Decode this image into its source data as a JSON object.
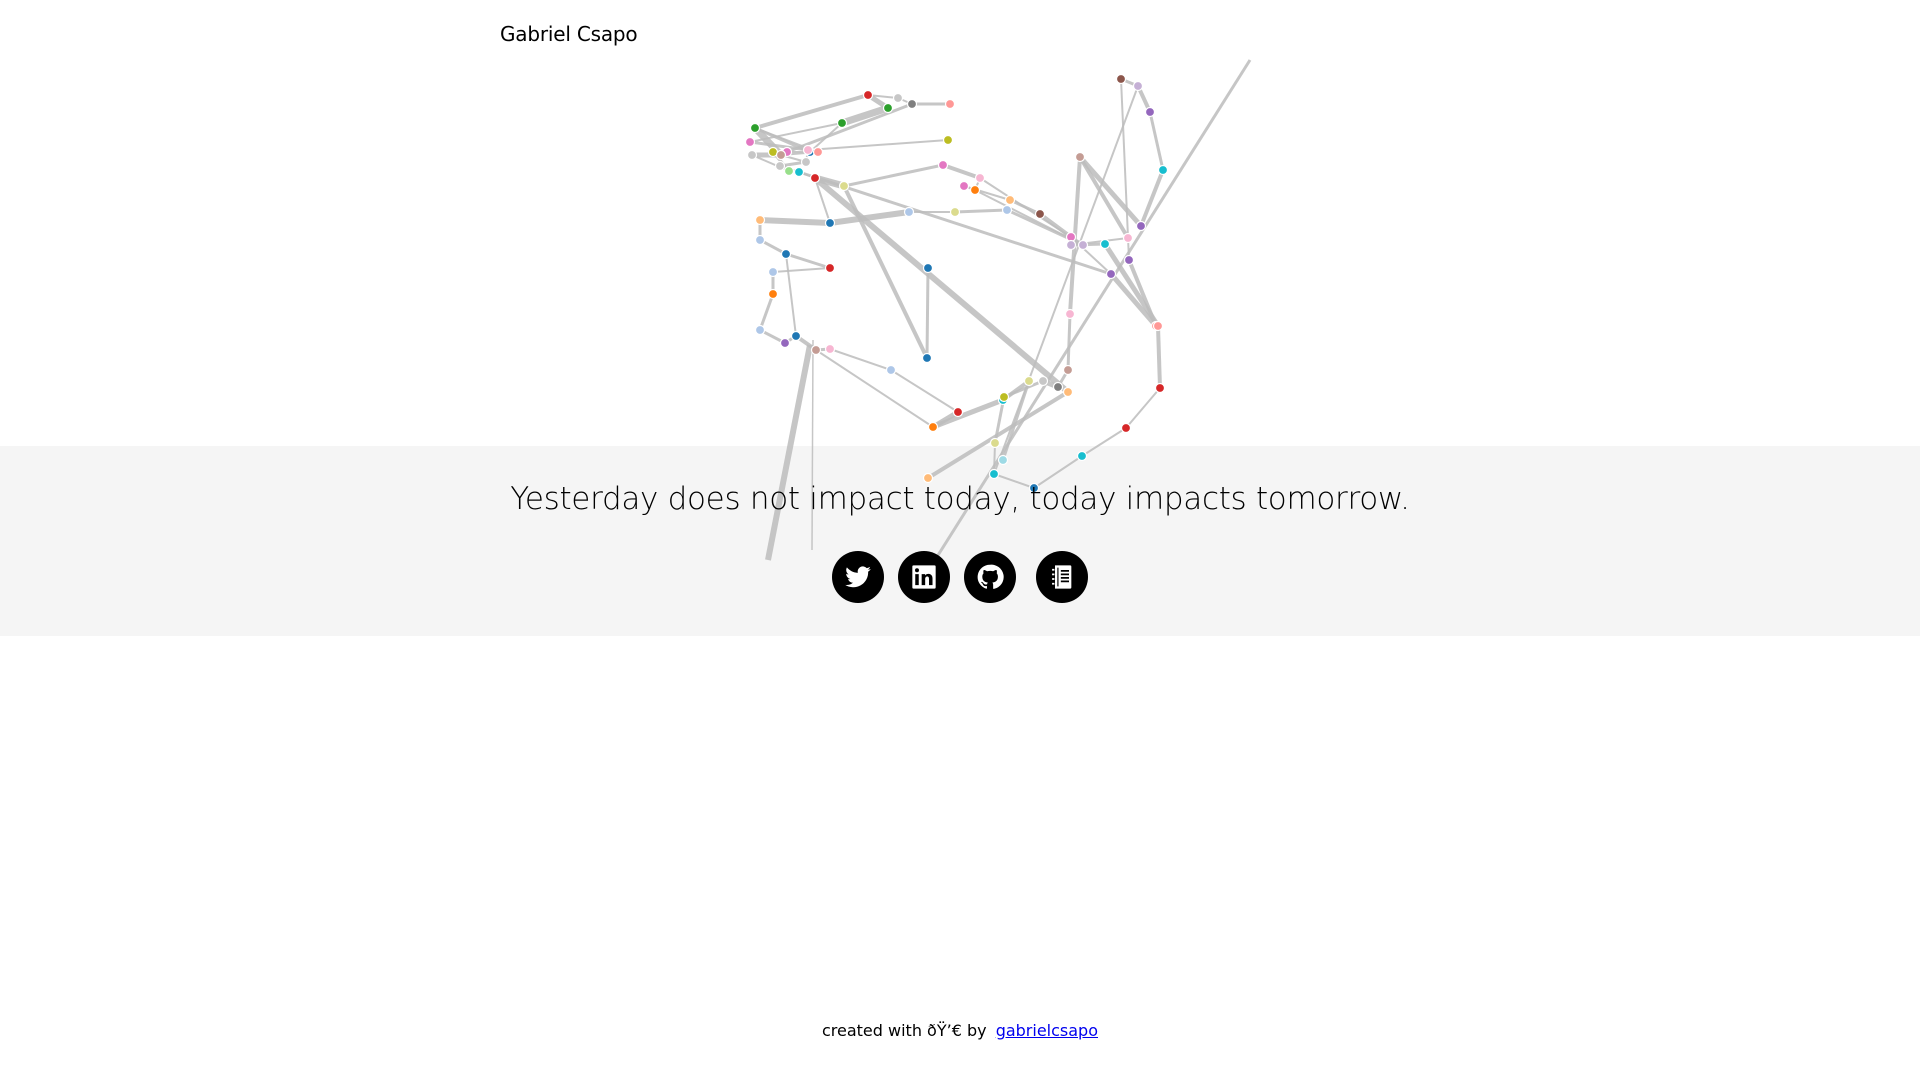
{
  "header": {
    "site_title": "Gabriel Csapo"
  },
  "hero": {
    "quote": "Yesterday does not impact today, today impacts tomorrow.",
    "band_color": "#f4f4f4"
  },
  "social": [
    {
      "name": "twitter",
      "icon": "twitter-icon"
    },
    {
      "name": "linkedin",
      "icon": "linkedin-icon"
    },
    {
      "name": "github",
      "icon": "github-icon"
    },
    {
      "name": "blog",
      "icon": "notebook-icon"
    }
  ],
  "graph": {
    "edge_color": "#bdbdbd",
    "node_colors": [
      "#d62728",
      "#2ca02c",
      "#1f77b4",
      "#ff7f0e",
      "#9467bd",
      "#8c564b",
      "#e377c2",
      "#7f7f7f",
      "#bcbd22",
      "#17becf",
      "#aec7e8",
      "#ffbb78",
      "#98df8a",
      "#ff9896",
      "#c5b0d5",
      "#c49c94",
      "#f7b6d2",
      "#c7c7c7",
      "#dbdb8d",
      "#9edae5"
    ]
  },
  "footer": {
    "created_text": "created with ðŸ’€ by",
    "link_text": "gabrielcsapo"
  }
}
